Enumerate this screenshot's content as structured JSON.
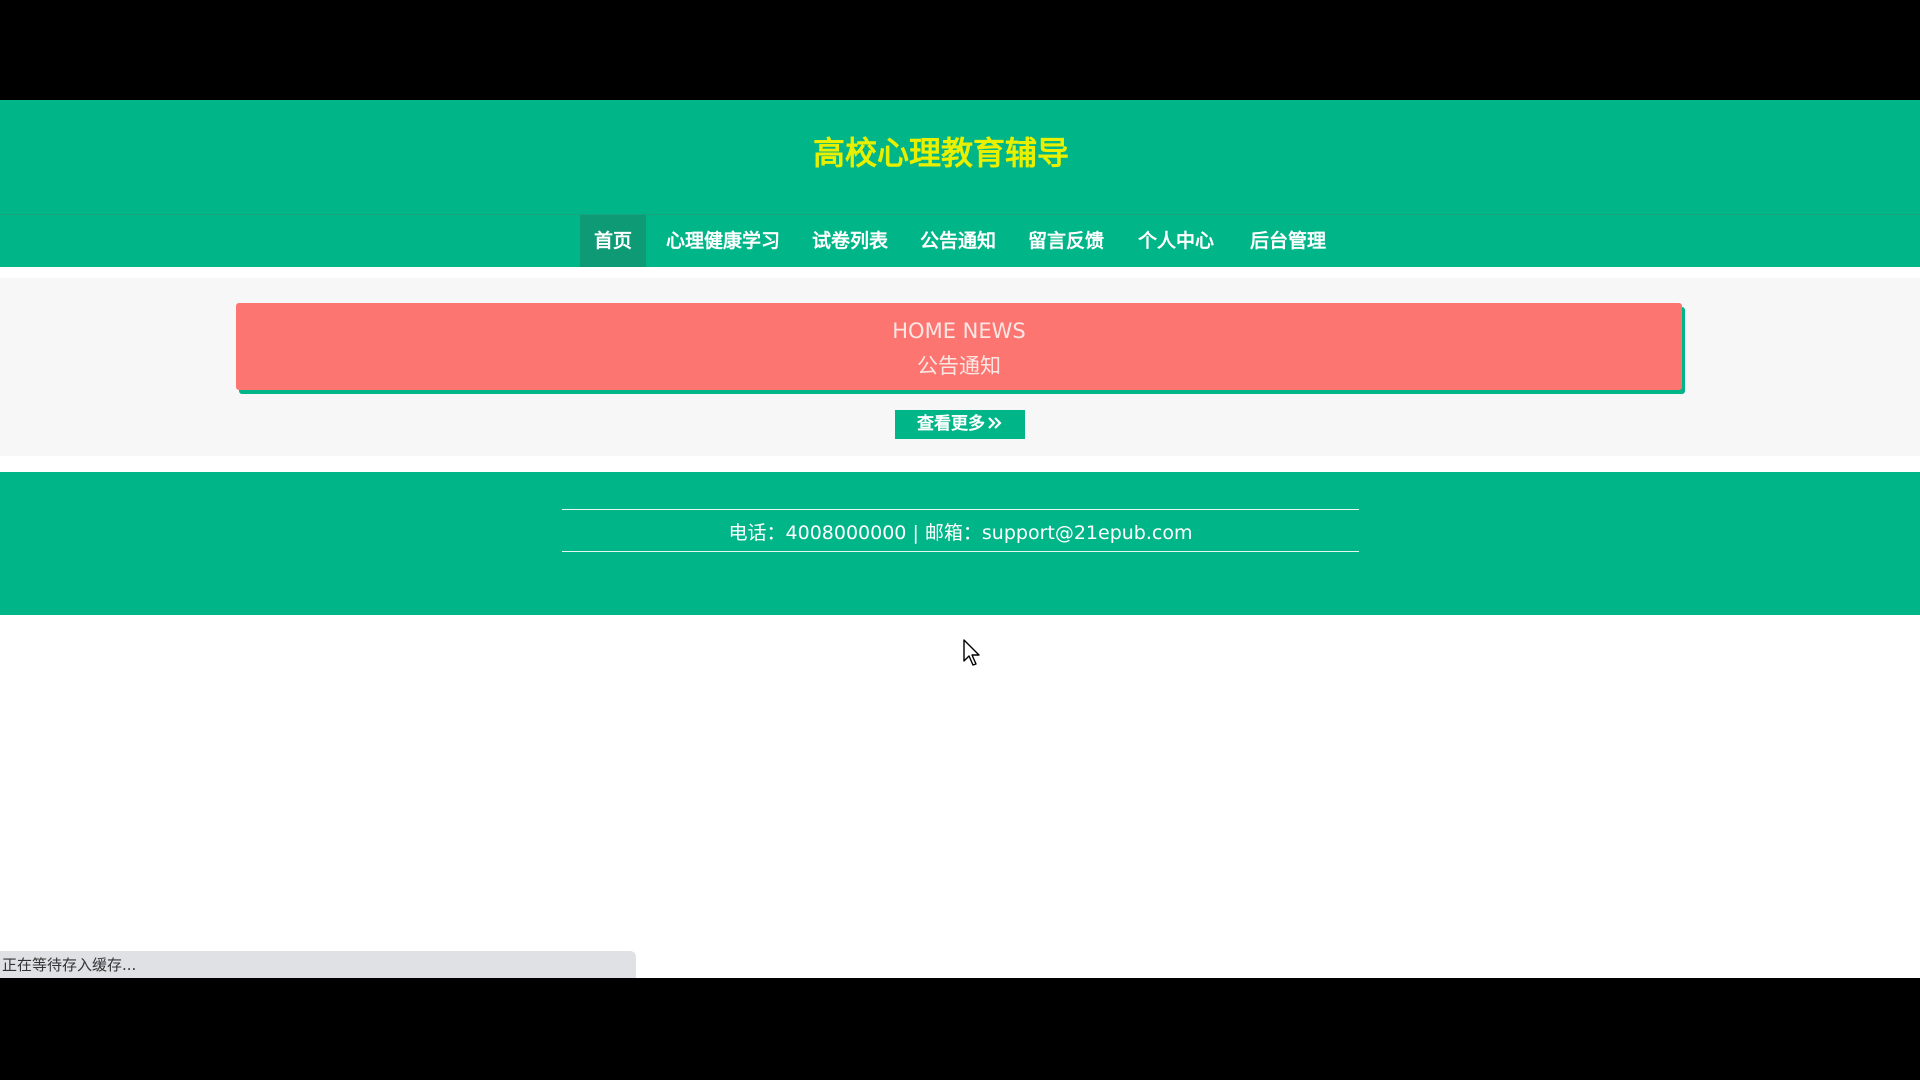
{
  "header": {
    "site_title": "高校心理教育辅导",
    "nav": [
      {
        "label": "首页",
        "active": true
      },
      {
        "label": "心理健康学习",
        "active": false
      },
      {
        "label": "试卷列表",
        "active": false
      },
      {
        "label": "公告通知",
        "active": false
      },
      {
        "label": "留言反馈",
        "active": false
      },
      {
        "label": "个人中心",
        "active": false
      },
      {
        "label": "后台管理",
        "active": false
      }
    ]
  },
  "notice": {
    "title_en": "HOME NEWS",
    "title_cn": "公告通知",
    "more_label": "查看更多",
    "more_icon": "double-chevron-right-icon"
  },
  "footer": {
    "contact": "电话：4008000000 | 邮箱：support@21epub.com"
  },
  "status_bar": {
    "text": "正在等待存入缓存..."
  },
  "colors": {
    "primary": "#00b587",
    "nav_active": "#0d9a74",
    "title": "#e8f000",
    "banner": "#fd7571"
  }
}
